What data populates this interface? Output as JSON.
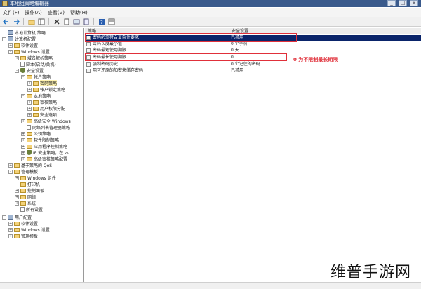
{
  "window": {
    "title": "本地组策略编辑器",
    "buttons": [
      "_",
      "□",
      "×"
    ]
  },
  "menu": [
    "文件(F)",
    "操作(A)",
    "查看(V)",
    "帮助(H)"
  ],
  "toolbar_icons": [
    "back-icon",
    "forward-icon",
    "up-folder-icon",
    "show-tree-icon",
    "delete-icon",
    "properties-icon",
    "refresh-icon",
    "export-icon",
    "help-icon",
    "view-icon"
  ],
  "tree": [
    {
      "label": "本地计算机 策略",
      "icon": "computer",
      "exp": ""
    },
    {
      "label": "计算机配置",
      "icon": "computer",
      "exp": "-"
    },
    {
      "label": "软件设置",
      "icon": "folder",
      "exp": "+"
    },
    {
      "label": "Windows 设置",
      "icon": "folder",
      "exp": "-"
    },
    {
      "label": "域名解析策略",
      "icon": "folder",
      "exp": "+"
    },
    {
      "label": "脚本(启动/关机)",
      "icon": "doc",
      "exp": ""
    },
    {
      "label": "安全设置",
      "icon": "shield",
      "exp": "-"
    },
    {
      "label": "帐户策略",
      "icon": "folder",
      "exp": "-"
    },
    {
      "label": "密码策略",
      "icon": "folder",
      "exp": "+"
    },
    {
      "label": "帐户锁定策略",
      "icon": "folder",
      "exp": "+"
    },
    {
      "label": "本地策略",
      "icon": "folder",
      "exp": "-"
    },
    {
      "label": "审核策略",
      "icon": "folder",
      "exp": "+"
    },
    {
      "label": "用户权限分配",
      "icon": "folder",
      "exp": "+"
    },
    {
      "label": "安全选项",
      "icon": "folder",
      "exp": "+"
    },
    {
      "label": "高级安全 Windows",
      "icon": "folder",
      "exp": "+"
    },
    {
      "label": "网络列表管理器策略",
      "icon": "doc",
      "exp": ""
    },
    {
      "label": "公钥策略",
      "icon": "folder",
      "exp": "+"
    },
    {
      "label": "软件限制策略",
      "icon": "folder",
      "exp": "+"
    },
    {
      "label": "应用程序控制策略",
      "icon": "folder",
      "exp": "+"
    },
    {
      "label": "IP 安全策略，在 本",
      "icon": "shield",
      "exp": "+"
    },
    {
      "label": "高级审核策略配置",
      "icon": "folder",
      "exp": "+"
    },
    {
      "label": "基于策略的 QoS",
      "icon": "folder",
      "exp": "+"
    },
    {
      "label": "管理模板",
      "icon": "folder",
      "exp": "-"
    },
    {
      "label": "Windows 组件",
      "icon": "folder",
      "exp": "+"
    },
    {
      "label": "打印机",
      "icon": "folder",
      "exp": ""
    },
    {
      "label": "控制面板",
      "icon": "folder",
      "exp": "+"
    },
    {
      "label": "网络",
      "icon": "folder",
      "exp": "+"
    },
    {
      "label": "系统",
      "icon": "folder",
      "exp": "+"
    },
    {
      "label": "所有设置",
      "icon": "doc",
      "exp": ""
    },
    {
      "label": "用户配置",
      "icon": "computer",
      "exp": "-"
    },
    {
      "label": "软件设置",
      "icon": "folder",
      "exp": "+"
    },
    {
      "label": "Windows 设置",
      "icon": "folder",
      "exp": "+"
    },
    {
      "label": "管理模板",
      "icon": "folder",
      "exp": "+"
    }
  ],
  "list": {
    "col_policy": "策略",
    "col_setting": "安全设置",
    "rows": [
      {
        "name": "密码必须符合复杂性要求",
        "value": "已禁用"
      },
      {
        "name": "密码长度最小值",
        "value": "0 个字符"
      },
      {
        "name": "密码最短使用期限",
        "value": "0 天"
      },
      {
        "name": "密码最长使用期限",
        "value": "0"
      },
      {
        "name": "强制密码历史",
        "value": "0 个记住的密码"
      },
      {
        "name": "用可还原的加密来储存密码",
        "value": "已禁用"
      }
    ]
  },
  "annotation": "0 为不限制最长期限",
  "watermark": "维普手游网",
  "colors": {
    "highlight": "#e0303a",
    "selection": "#0a246a"
  }
}
